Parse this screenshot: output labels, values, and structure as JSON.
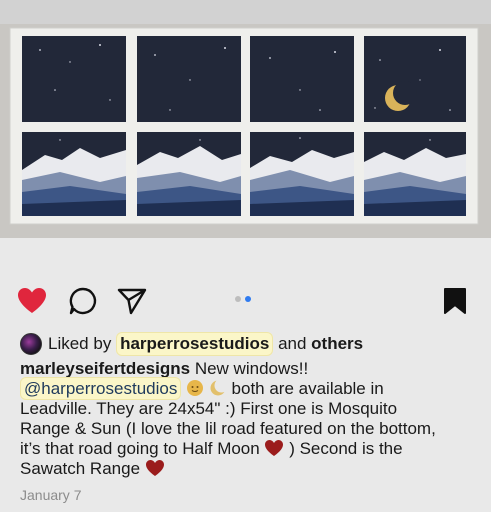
{
  "post": {
    "liked_by_prefix": "Liked by",
    "liked_by_user": "harperrosestudios",
    "liked_by_suffix": "and",
    "liked_by_others": "others",
    "author": "marleyseifertdesigns",
    "caption_line1": "New windows!!",
    "mention": "@harperrosestudios",
    "caption_line2_tail": "both are available in",
    "caption_line3": "Leadville. They are 24x54\" :) First one is Mosquito",
    "caption_line4": "Range & Sun (I love the lil road featured on the bottom,",
    "caption_line5": "it’s that road going to Half Moon",
    "caption_line5_tail": ") Second is the",
    "caption_line6": "Sawatch Range",
    "date": "January 7"
  },
  "carousel": {
    "count": 2,
    "active_index": 1
  },
  "icons": {
    "like": "heart-icon",
    "comment": "comment-icon",
    "share": "paper-plane-icon",
    "save": "bookmark-icon",
    "sun": "sun-emoji",
    "moon": "crescent-moon-emoji",
    "heart_emoji": "red-heart-emoji"
  },
  "colors": {
    "like_red": "#e0263d",
    "carousel_active": "#2f7bf0",
    "highlight": "#fbf6c8",
    "heart_emoji": "#9b1c1c"
  }
}
